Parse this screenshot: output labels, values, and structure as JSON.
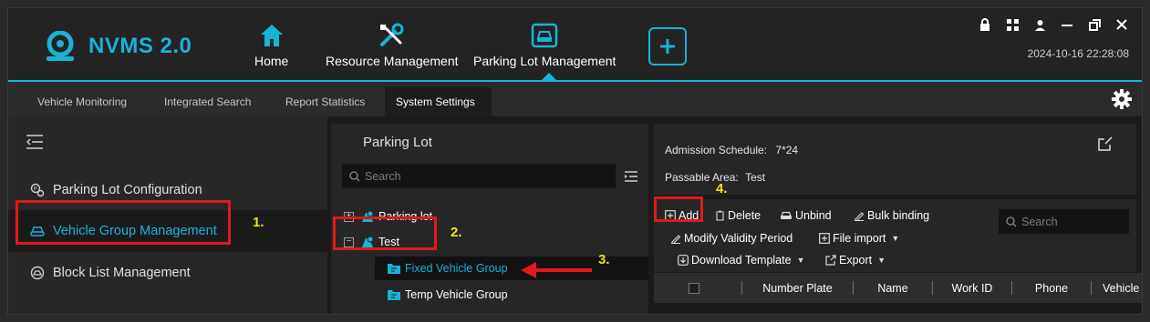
{
  "app": {
    "name": "NVMS 2.0",
    "datetime": "2024-10-16 22:28:08"
  },
  "nav": [
    {
      "label": "Home",
      "icon": "home-icon"
    },
    {
      "label": "Resource Management",
      "icon": "tools-icon"
    },
    {
      "label": "Parking Lot Management",
      "icon": "parking-car-icon",
      "active": true
    }
  ],
  "tabs": [
    {
      "label": "Vehicle Monitoring"
    },
    {
      "label": "Integrated Search"
    },
    {
      "label": "Report Statistics"
    },
    {
      "label": "System Settings",
      "active": true
    }
  ],
  "sidebar": {
    "items": [
      {
        "label": "Parking Lot Configuration",
        "icon": "parking-config-icon"
      },
      {
        "label": "Vehicle Group Management",
        "icon": "car-icon",
        "active": true
      },
      {
        "label": "Block List Management",
        "icon": "block-list-icon"
      }
    ]
  },
  "tree": {
    "title": "Parking Lot",
    "search_placeholder": "Search",
    "nodes": [
      {
        "label": "Parking lot",
        "expander": "+"
      },
      {
        "label": "Test",
        "expander": "−"
      },
      {
        "label": "Fixed Vehicle Group",
        "selected": true
      },
      {
        "label": "Temp Vehicle Group"
      }
    ]
  },
  "details": {
    "admission_label": "Admission Schedule:",
    "admission_value": "7*24",
    "passable_label": "Passable Area:",
    "passable_value": "Test"
  },
  "toolbar": {
    "add": "Add",
    "delete": "Delete",
    "unbind": "Unbind",
    "bulk_binding": "Bulk binding",
    "search_placeholder": "Search",
    "modify_validity": "Modify Validity Period",
    "file_import": "File import",
    "download_template": "Download Template",
    "export": "Export"
  },
  "table": {
    "columns": [
      "Number Plate",
      "Name",
      "Work ID",
      "Phone",
      "Vehicle"
    ]
  },
  "annotations": {
    "step1": "1.",
    "step2": "2.",
    "step3": "3.",
    "step4": "4."
  },
  "colors": {
    "accent": "#19b3d6",
    "highlight_box": "#e0191b",
    "step_label": "#f2e21a"
  }
}
